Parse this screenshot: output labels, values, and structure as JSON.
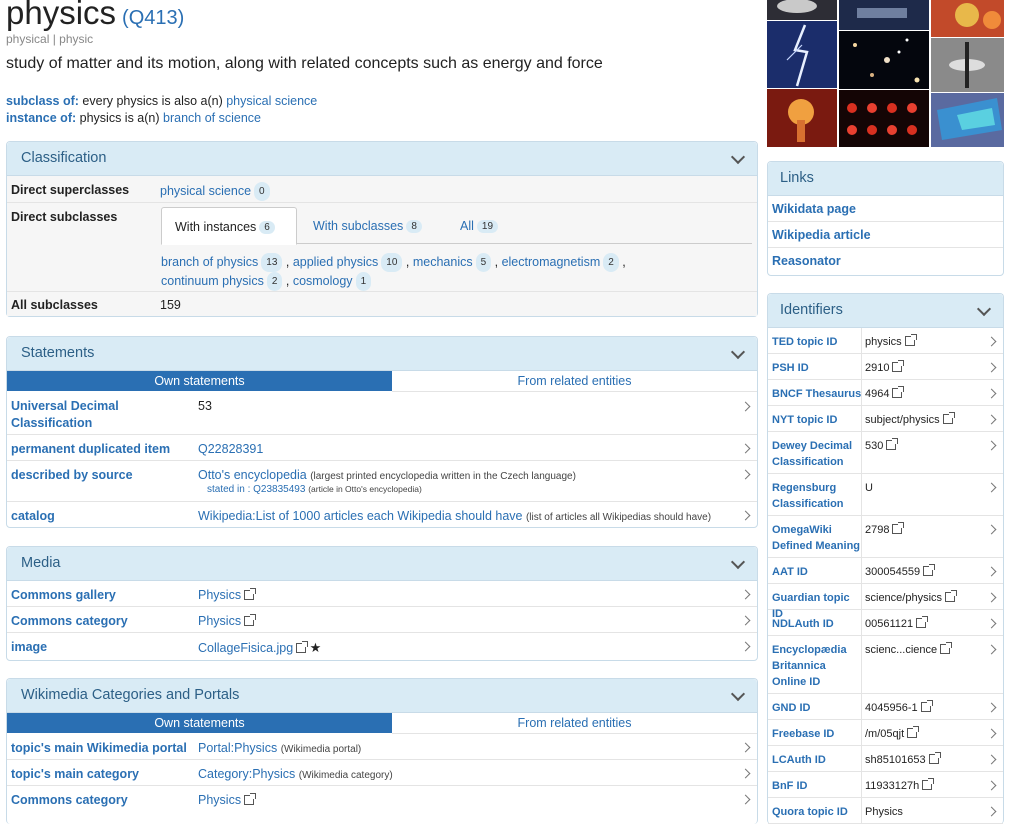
{
  "entity": {
    "title": "physics",
    "qid": "(Q413)",
    "aliases": "physical | physic",
    "description": "study of matter and its motion, along with related concepts such as energy and force",
    "subclass_label": "subclass of:",
    "subclass_text": "every physics is also a(n)",
    "subclass_link": "physical science",
    "instance_label": "instance of:",
    "instance_text": "physics is a(n)",
    "instance_link": "branch of science"
  },
  "classification": {
    "title": "Classification",
    "superclasses_label": "Direct superclasses",
    "superclass": "physical science",
    "superclass_count": "0",
    "subclasses_label": "Direct subclasses",
    "tabs": [
      {
        "label": "With instances",
        "count": "6"
      },
      {
        "label": "With subclasses",
        "count": "8"
      },
      {
        "label": "All",
        "count": "19"
      }
    ],
    "subclasses": [
      {
        "name": "branch of physics",
        "count": "13"
      },
      {
        "name": "applied physics",
        "count": "10"
      },
      {
        "name": "mechanics",
        "count": "5"
      },
      {
        "name": "electromagnetism",
        "count": "2"
      },
      {
        "name": "continuum physics",
        "count": "2"
      },
      {
        "name": "cosmology",
        "count": "1"
      }
    ],
    "all_label": "All subclasses",
    "all_count": "159"
  },
  "statements": {
    "title": "Statements",
    "tab_own": "Own statements",
    "tab_related": "From related entities",
    "rows": [
      {
        "label": "Universal Decimal Classification",
        "value": "53"
      },
      {
        "label": "permanent duplicated item",
        "value": "Q22828391"
      },
      {
        "label": "described by source",
        "value": "Otto's encyclopedia",
        "note": "(largest printed encyclopedia written in the Czech language)",
        "qual_label": "stated in :",
        "qual_value": "Q23835493",
        "qual_note": "(article in Otto's encyclopedia)"
      },
      {
        "label": "catalog",
        "value": "Wikipedia:List of 1000 articles each Wikipedia should have",
        "note": "(list of articles all Wikipedias should have)"
      }
    ]
  },
  "media": {
    "title": "Media",
    "rows": [
      {
        "label": "Commons gallery",
        "value": "Physics"
      },
      {
        "label": "Commons category",
        "value": "Physics"
      },
      {
        "label": "image",
        "value": "CollageFisica.jpg",
        "star": "★"
      }
    ]
  },
  "wikimedia": {
    "title": "Wikimedia Categories and Portals",
    "tab_own": "Own statements",
    "tab_related": "From related entities",
    "rows": [
      {
        "label": "topic's main Wikimedia portal",
        "value": "Portal:Physics",
        "note": "(Wikimedia portal)"
      },
      {
        "label": "topic's main category",
        "value": "Category:Physics",
        "note": "(Wikimedia category)"
      },
      {
        "label": "Commons category",
        "value": "Physics"
      }
    ]
  },
  "links": {
    "title": "Links",
    "items": [
      "Wikidata page",
      "Wikipedia article",
      "Reasonator"
    ]
  },
  "identifiers": {
    "title": "Identifiers",
    "rows": [
      {
        "key": "TED topic ID",
        "value": "physics",
        "ext": true
      },
      {
        "key": "PSH ID",
        "value": "2910",
        "ext": true
      },
      {
        "key": "BNCF Thesaurus",
        "value": "4964",
        "ext": true
      },
      {
        "key": "NYT topic ID",
        "value": "subject/physics",
        "ext": true
      },
      {
        "key": "Dewey Decimal Classification",
        "value": "530",
        "ext": true
      },
      {
        "key": "Regensburg Classification",
        "value": "U",
        "ext": false
      },
      {
        "key": "OmegaWiki Defined Meaning",
        "value": "2798",
        "ext": true
      },
      {
        "key": "AAT ID",
        "value": "300054559",
        "ext": true
      },
      {
        "key": "Guardian topic ID",
        "value": "science/physics",
        "ext": true
      },
      {
        "key": "NDLAuth ID",
        "value": "00561121",
        "ext": true
      },
      {
        "key": "Encyclopædia Britannica Online ID",
        "value": "scienc...cience",
        "ext": true
      },
      {
        "key": "GND ID",
        "value": "4045956-1",
        "ext": true
      },
      {
        "key": "Freebase ID",
        "value": "/m/05qjt",
        "ext": true
      },
      {
        "key": "LCAuth ID",
        "value": "sh85101653",
        "ext": true
      },
      {
        "key": "BnF ID",
        "value": "11933127h",
        "ext": true
      },
      {
        "key": "Quora topic ID",
        "value": "Physics",
        "ext": false
      }
    ]
  },
  "colors": {
    "link": "#2a6fb3",
    "panel_head": "#d9ebf5",
    "active_tab": "#2a6fb3"
  }
}
